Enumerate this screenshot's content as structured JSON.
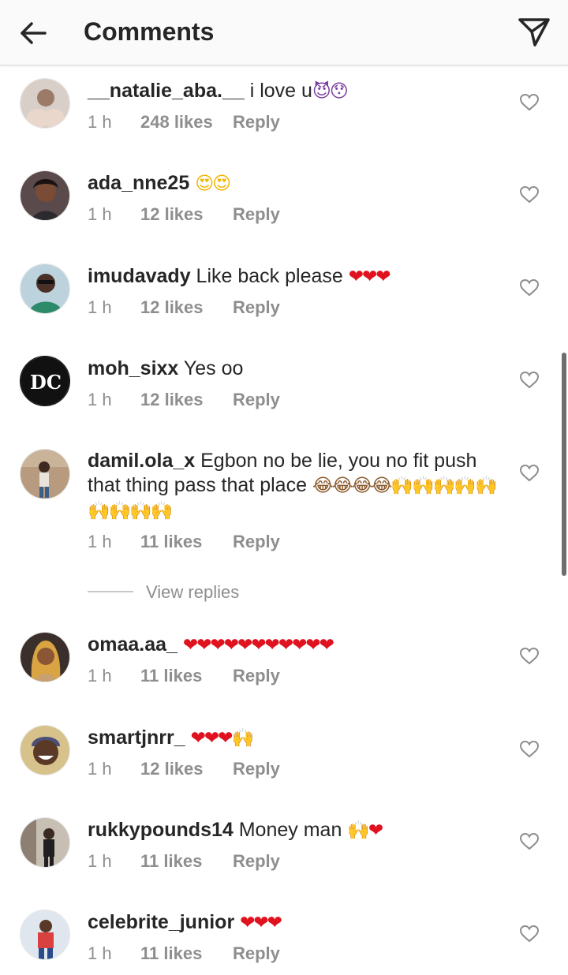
{
  "header": {
    "title": "Comments"
  },
  "comments": [
    {
      "user": "__natalie_aba.__",
      "body": " i love u",
      "emoji": "😈😯",
      "emoji_color": "pur",
      "time": "1 h",
      "likes": "248 likes",
      "reply": "Reply"
    },
    {
      "user": "ada_nne25",
      "body": " ",
      "emoji": "😍😍",
      "emoji_color": "yel",
      "time": "1 h",
      "likes": "12 likes",
      "reply": "Reply"
    },
    {
      "user": "imudavady",
      "body": " Like back please ",
      "emoji": "❤❤❤",
      "emoji_color": "red",
      "time": "1 h",
      "likes": "12 likes",
      "reply": "Reply"
    },
    {
      "user": "moh_sixx",
      "body": " Yes oo",
      "emoji": "",
      "emoji_color": "red",
      "time": "1 h",
      "likes": "12 likes",
      "reply": "Reply"
    },
    {
      "user": "damil.ola_x",
      "body": " Egbon no be lie, you no fit push that thing pass that place ",
      "emoji": "😂😂😂😂🙌🙌🙌🙌🙌🙌🙌🙌🙌",
      "emoji_color": "brn",
      "time": "1 h",
      "likes": "11 likes",
      "reply": "Reply"
    },
    {
      "user": "omaa.aa_",
      "body": " ",
      "emoji": "❤❤❤❤❤❤❤❤❤❤❤",
      "emoji_color": "red",
      "time": "1 h",
      "likes": "11 likes",
      "reply": "Reply"
    },
    {
      "user": "smartjnrr_",
      "body": " ",
      "emoji": "❤❤❤🙌",
      "emoji_color": "red",
      "time": "1 h",
      "likes": "12 likes",
      "reply": "Reply"
    },
    {
      "user": "rukkypounds14",
      "body": " Money man ",
      "emoji": "🙌❤",
      "emoji_color": "red",
      "time": "1 h",
      "likes": "11 likes",
      "reply": "Reply"
    },
    {
      "user": "celebrite_junior",
      "body": " ",
      "emoji": "❤❤❤",
      "emoji_color": "red",
      "time": "1 h",
      "likes": "11 likes",
      "reply": "Reply"
    }
  ],
  "view_replies": "View replies",
  "colors": {
    "text": "#262626",
    "secondary": "#8e8e8e",
    "heart": "#e0121f",
    "header_bg": "#fafafa"
  }
}
